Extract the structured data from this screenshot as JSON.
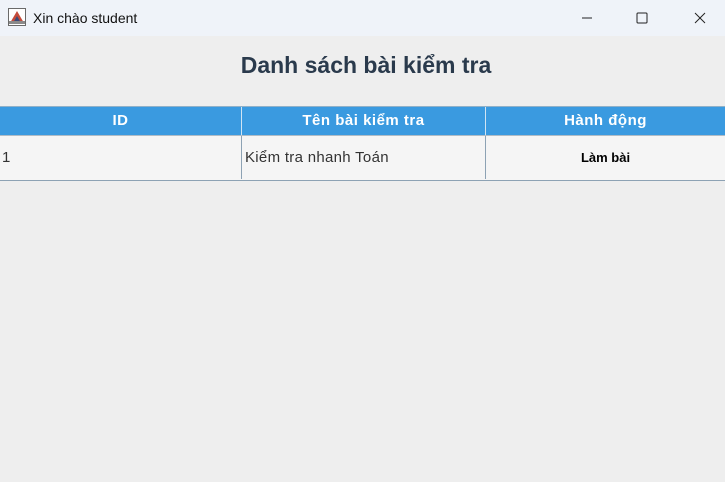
{
  "window": {
    "title": "Xin chào student",
    "app_icon": "java-app-icon",
    "controls": {
      "minimize_icon": "minimize-icon",
      "maximize_icon": "maximize-icon",
      "close_icon": "close-icon"
    }
  },
  "heading": "Danh sách bài kiểm tra",
  "colors": {
    "header_background": "#3a9ae0",
    "header_text": "#ffffff",
    "heading_text": "#2a3a4c",
    "window_background": "#eeeeee"
  },
  "table": {
    "columns": [
      "ID",
      "Tên bài kiểm tra",
      "Hành động"
    ],
    "rows": [
      {
        "id": "1",
        "name": "Kiểm tra nhanh Toán",
        "action": "Làm bài"
      }
    ]
  }
}
